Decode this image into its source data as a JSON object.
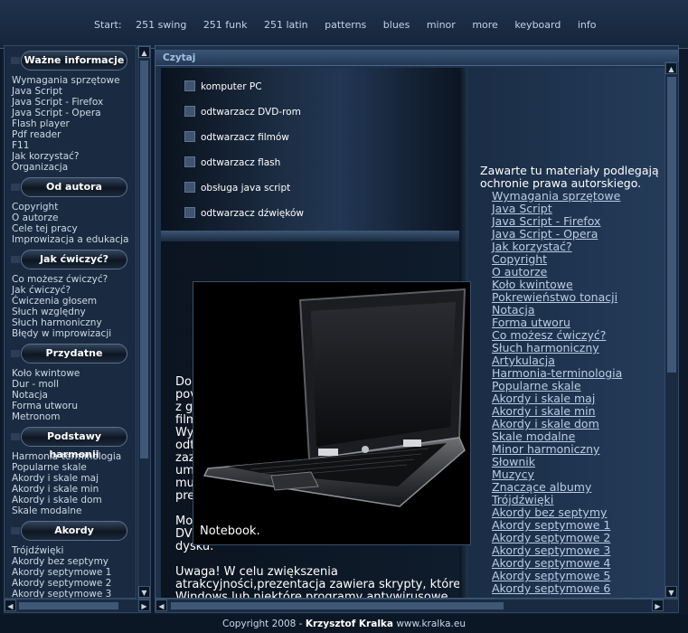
{
  "nav": {
    "start_label": "Start:",
    "links": [
      "251 swing",
      "251 funk",
      "251 latin",
      "patterns",
      "blues",
      "minor",
      "more",
      "keyboard",
      "info"
    ]
  },
  "sidebar": {
    "sections": [
      {
        "title": "Ważne informacje",
        "items": [
          "Wymagania sprzętowe",
          "Java Script",
          "Java Script - Firefox",
          "Java Script - Opera",
          "Flash player",
          "Pdf reader",
          "F11",
          "Jak korzystać?",
          "Organizacja"
        ]
      },
      {
        "title": "Od autora",
        "items": [
          "Copyright",
          "O autorze",
          "Cele tej pracy",
          "Improwizacja a edukacja"
        ]
      },
      {
        "title": "Jak ćwiczyć?",
        "items": [
          "Co możesz ćwiczyć?",
          "Jak ćwiczyć?",
          "Ćwiczenia głosem",
          "Słuch względny",
          "Słuch harmoniczny",
          "Błędy w improwizacji"
        ]
      },
      {
        "title": "Przydatne",
        "items": [
          "Koło kwintowe",
          "Dur - moll",
          "Notacja",
          "Forma utworu",
          "Metronom"
        ]
      },
      {
        "title": "Podstawy harmonii",
        "items": [
          "Harmonia-terminologia",
          "Popularne skale",
          "Akordy i skale maj",
          "Akordy i skale min",
          "Akordy i skale dom",
          "Skale modalne"
        ]
      },
      {
        "title": "Akordy",
        "items": [
          "Trójdźwięki",
          "Akordy bez septymy",
          "Akordy septymowe 1",
          "Akordy septymowe 2",
          "Akordy septymowe 3"
        ]
      }
    ]
  },
  "main": {
    "tab": "Czytaj",
    "requirements": [
      "komputer PC",
      "odtwarzacz DVD-rom",
      "odtwarzacz filmów",
      "odtwarzacz flash",
      "obsługa java script",
      "odtwarzacz dźwięków"
    ],
    "text_lines_1": [
      "Do",
      "pov",
      "z g",
      "film",
      "Wy",
      "odt",
      "zaz",
      "um",
      "mu",
      "pre"
    ],
    "text_lines_2": [
      "Moż",
      "DVD",
      "dysku."
    ],
    "text_lines_3": [
      "Uwaga! W celu zwiększenia",
      "atrakcyjności,prezentacja zawiera skrypty, które",
      "Windows lub niektóre programy antywirusowe"
    ],
    "popup_caption": "Notebook.",
    "right_intro": "Zawarte tu materiały podlegają ochronie prawa autorskiego.",
    "right_links": [
      "Wymagania sprzętowe",
      "Java Script",
      "Java Script - Firefox",
      "Java Script - Opera",
      "Jak korzystać?",
      "Copyright",
      "O autorze",
      "Koło kwintowe",
      "Pokrewieństwo tonacji",
      "Notacja",
      "Forma utworu",
      "Co możesz ćwiczyć?",
      "Słuch harmoniczny",
      "Artykulacja",
      "Harmonia-terminologia",
      "Popularne skale",
      "Akordy i skale maj",
      "Akordy i skale min",
      "Akordy i skale dom",
      "Skale modalne",
      "Minor harmoniczny",
      "Słownik",
      "Muzycy",
      "Znaczące albumy",
      "Trójdźwięki",
      "Akordy bez septymy",
      "Akordy septymowe 1",
      "Akordy septymowe 2",
      "Akordy septymowe 3",
      "Akordy septymowe 4",
      "Akordy septymowe 5",
      "Akordy septymowe 6"
    ]
  },
  "footer": {
    "prefix": "Copyright 2008 - ",
    "author": "Krzysztof Kralka",
    "site": " www.kralka.eu"
  }
}
